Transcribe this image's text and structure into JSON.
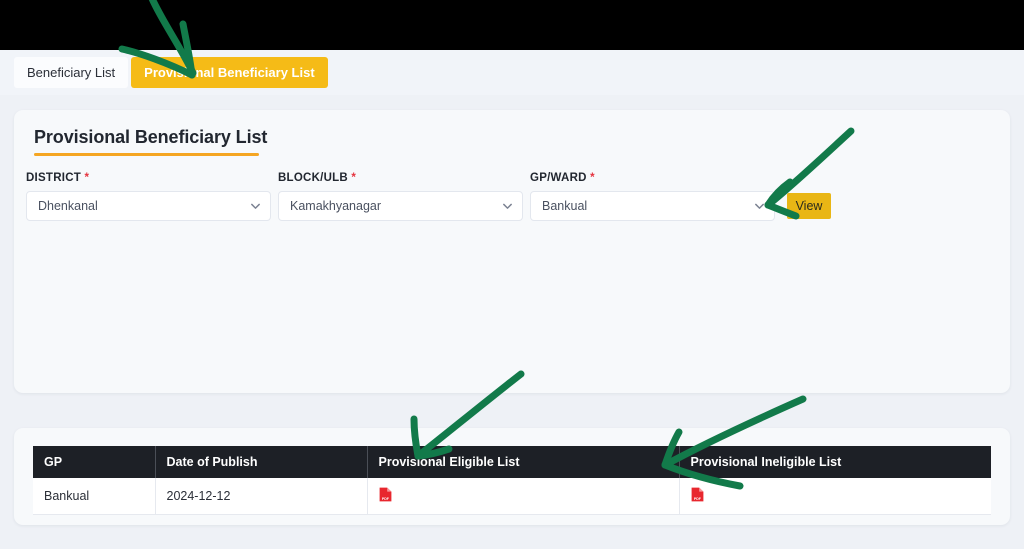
{
  "window": {
    "background_color": "#eef1f6",
    "topbar_color": "#000000"
  },
  "tabs": [
    {
      "label": "Beneficiary List",
      "active": false
    },
    {
      "label": "Provisional Beneficiary List",
      "active": true
    }
  ],
  "form_card": {
    "title": "Provisional Beneficiary List",
    "accent_color": "#f5a623",
    "fields": [
      {
        "label": "DISTRICT",
        "required_marker": "*",
        "value": "Dhenkanal",
        "icon": "chevron-down-icon"
      },
      {
        "label": "BLOCK/ULB",
        "required_marker": "*",
        "value": "Kamakhyanagar",
        "icon": "chevron-down-icon"
      },
      {
        "label": "GP/WARD",
        "required_marker": "*",
        "value": "Bankual",
        "icon": "chevron-down-icon"
      }
    ],
    "view_button": {
      "label": "View",
      "color": "#e9b615",
      "text_color": "#2a2a1d"
    }
  },
  "table_card": {
    "header_bg": "#1d2026",
    "columns": [
      "GP",
      "Date of Publish",
      "Provisional Eligible List",
      "Provisional Ineligible List"
    ],
    "rows": [
      {
        "gp": "Bankual",
        "date_of_publish": "2024-12-12",
        "eligible_list": "pdf-icon",
        "ineligible_list": "pdf-icon"
      }
    ]
  },
  "annotations": {
    "color": "#127a4a",
    "arrows": [
      {
        "name": "arrow-to-provisional-tab"
      },
      {
        "name": "arrow-to-view-button"
      },
      {
        "name": "arrow-to-eligible-list-column"
      },
      {
        "name": "arrow-to-ineligible-list-column"
      }
    ]
  },
  "icons": {
    "pdf": "pdf-file-icon",
    "chevron": "chevron-down-icon"
  }
}
